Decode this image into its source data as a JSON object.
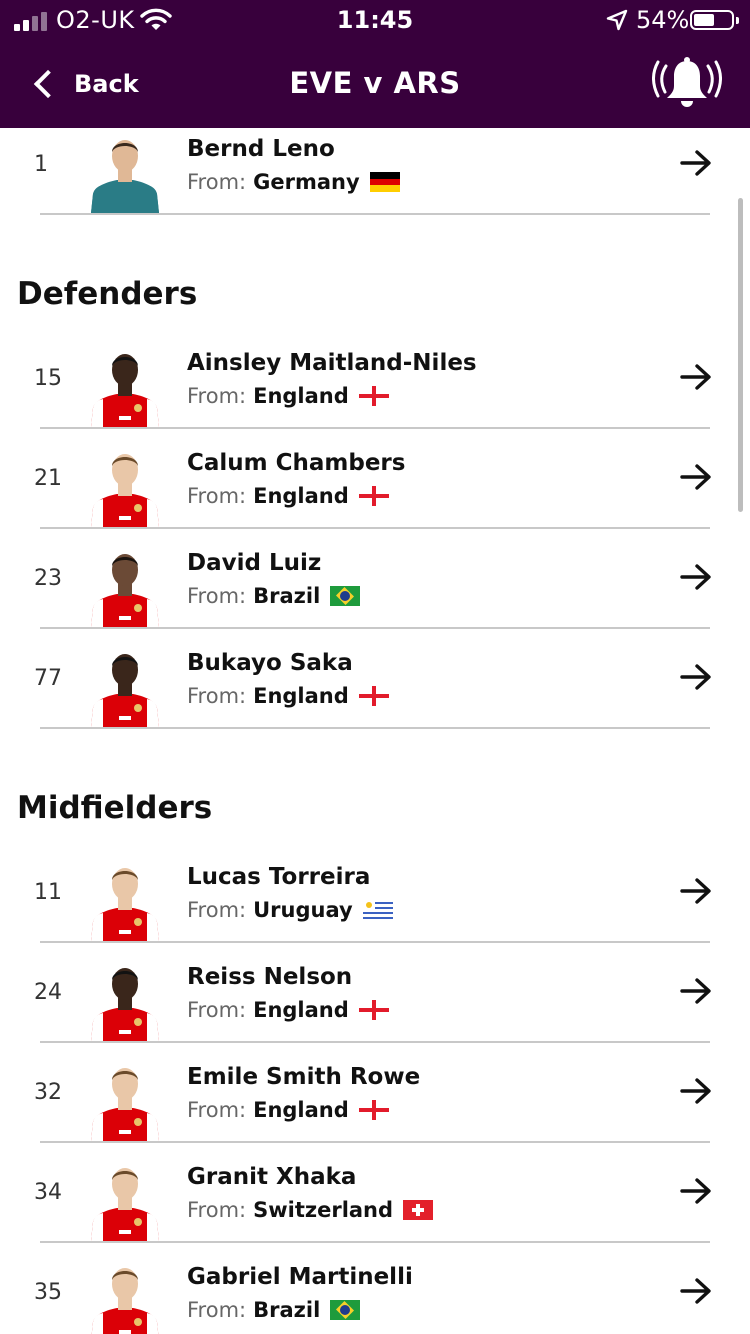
{
  "status_bar": {
    "carrier": "O2-UK",
    "time": "11:45",
    "battery": "54%"
  },
  "header": {
    "back_label": "Back",
    "title": "EVE v ARS",
    "bell_icon": "bell-ringing-icon"
  },
  "colors": {
    "header_bg": "#38003c",
    "divider": "#c8c8c8"
  },
  "squad": {
    "from_label": "From:",
    "goalkeeper": [
      {
        "number": "1",
        "name": "Bernd Leno",
        "country": "Germany",
        "flag": "germany-flag"
      }
    ],
    "defenders_title": "Defenders",
    "defenders": [
      {
        "number": "15",
        "name": "Ainsley Maitland-Niles",
        "country": "England",
        "flag": "england-flag"
      },
      {
        "number": "21",
        "name": "Calum Chambers",
        "country": "England",
        "flag": "england-flag"
      },
      {
        "number": "23",
        "name": "David Luiz",
        "country": "Brazil",
        "flag": "brazil-flag"
      },
      {
        "number": "77",
        "name": "Bukayo Saka",
        "country": "England",
        "flag": "england-flag"
      }
    ],
    "midfielders_title": "Midfielders",
    "midfielders": [
      {
        "number": "11",
        "name": "Lucas Torreira",
        "country": "Uruguay",
        "flag": "uruguay-flag"
      },
      {
        "number": "24",
        "name": "Reiss Nelson",
        "country": "England",
        "flag": "england-flag"
      },
      {
        "number": "32",
        "name": "Emile Smith Rowe",
        "country": "England",
        "flag": "england-flag"
      },
      {
        "number": "34",
        "name": "Granit Xhaka",
        "country": "Switzerland",
        "flag": "switzerland-flag"
      },
      {
        "number": "35",
        "name": "Gabriel Martinelli",
        "country": "Brazil",
        "flag": "brazil-flag"
      }
    ]
  }
}
